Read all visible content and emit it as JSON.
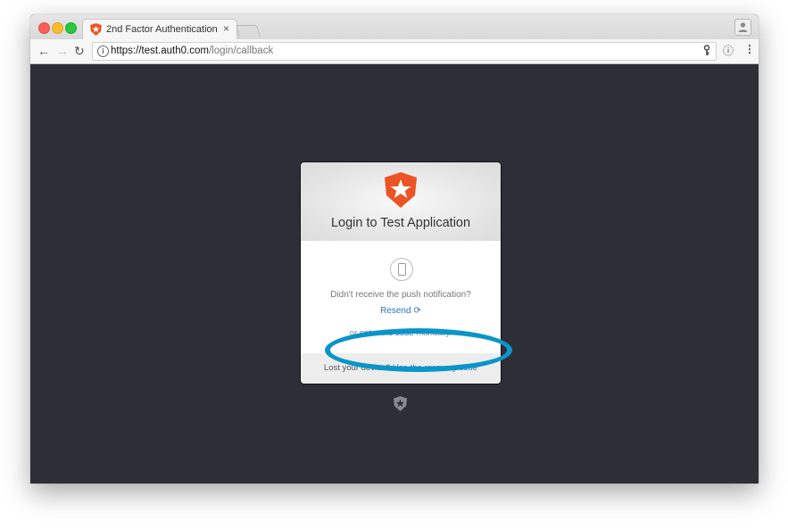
{
  "browser": {
    "tab_title": "2nd Factor Authentication",
    "tab_close": "×",
    "url_host": "https://test.auth0.com",
    "url_path": "/login/callback",
    "info_icon": "i",
    "key_icon": "key-icon",
    "page_info": "ⓘ",
    "menu": "⋮",
    "back": "←",
    "forward": "→",
    "reload": "↻"
  },
  "card": {
    "title": "Login to Test Application",
    "push_message": "Didn't receive the push notification?",
    "resend_label": "Resend",
    "resend_icon": "⟳",
    "manual_prefix": "or ",
    "manual_link": "enter the code",
    "manual_suffix": " manually.",
    "footer_prefix": "Lost your device? ",
    "footer_link": "Use the recovery code"
  },
  "colors": {
    "brand": "#eb5424",
    "link": "#2f74b5",
    "highlight": "#0a95c9",
    "page_bg": "#2d2e36"
  }
}
